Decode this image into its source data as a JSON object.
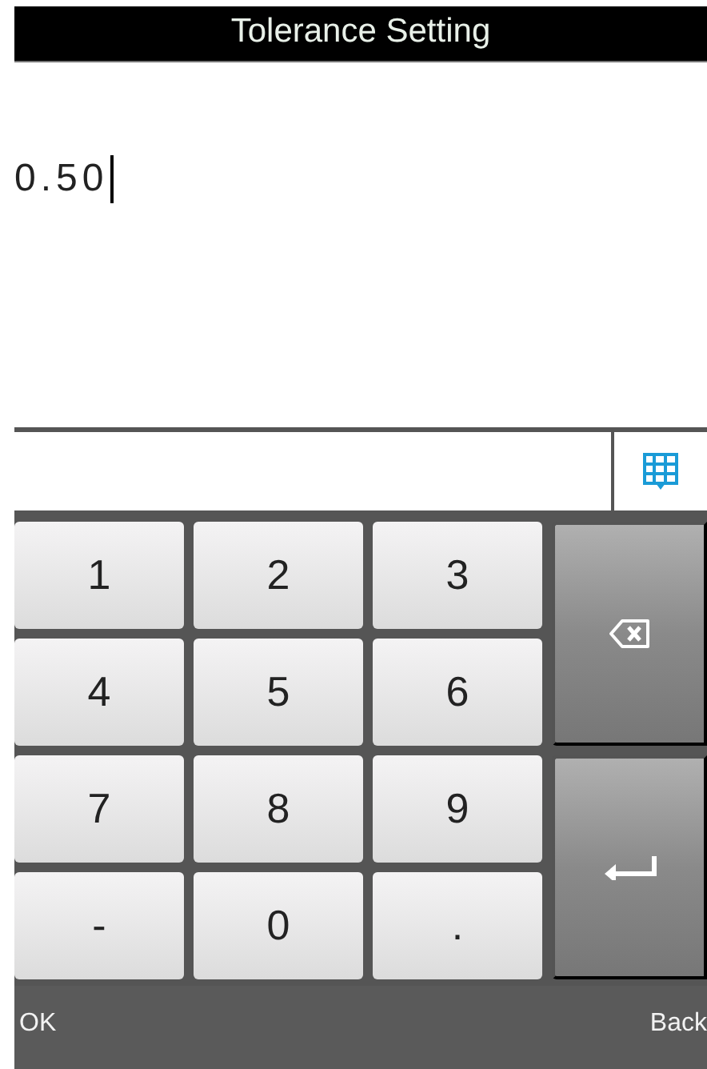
{
  "title": "Tolerance Setting",
  "value": "0.50",
  "keys": [
    {
      "kind": "char",
      "label": "1"
    },
    {
      "kind": "char",
      "label": "2"
    },
    {
      "kind": "char",
      "label": "3"
    },
    {
      "kind": "backspace"
    },
    {
      "kind": "char",
      "label": "4"
    },
    {
      "kind": "char",
      "label": "5"
    },
    {
      "kind": "char",
      "label": "6"
    },
    {
      "kind": "char",
      "label": "7"
    },
    {
      "kind": "char",
      "label": "8"
    },
    {
      "kind": "char",
      "label": "9"
    },
    {
      "kind": "enter"
    },
    {
      "kind": "char",
      "label": "-"
    },
    {
      "kind": "char",
      "label": "0"
    },
    {
      "kind": "char",
      "label": "."
    }
  ],
  "softkeys": {
    "left": "OK",
    "right": "Back"
  }
}
